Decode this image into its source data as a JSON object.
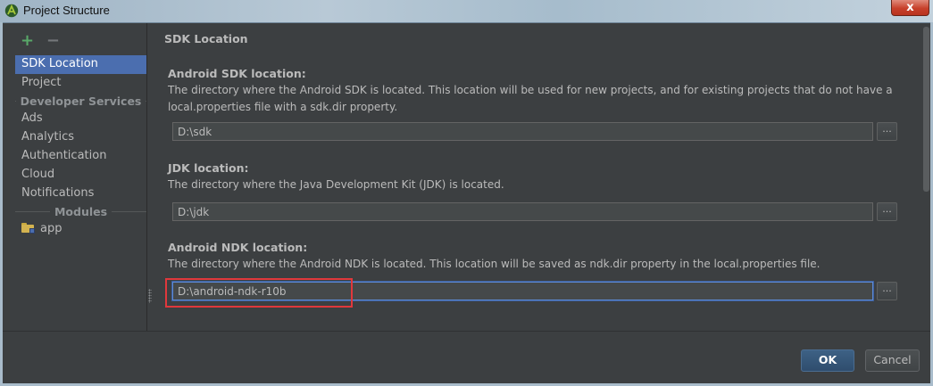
{
  "window": {
    "title": "Project Structure",
    "close_label": "x",
    "app_icon": "android-studio-icon"
  },
  "sidebar": {
    "add_label": "+",
    "remove_label": "−",
    "items": [
      {
        "label": "SDK Location",
        "selected": true
      },
      {
        "label": "Project"
      }
    ],
    "section_developer_services": "Developer Services",
    "services": [
      "Ads",
      "Analytics",
      "Authentication",
      "Cloud",
      "Notifications"
    ],
    "section_modules": "Modules",
    "modules": [
      {
        "label": "app",
        "icon": "module-folder-icon"
      }
    ]
  },
  "main": {
    "title": "SDK Location",
    "sdk": {
      "label": "Android SDK location:",
      "description": "The directory where the Android SDK is located. This location will be used for new projects, and for existing projects that do not have a local.properties file with a sdk.dir property.",
      "value": "D:\\sdk",
      "browse_label": "..."
    },
    "jdk": {
      "label": "JDK location:",
      "description": "The directory where the Java Development Kit (JDK) is located.",
      "value": "D:\\jdk",
      "browse_label": "..."
    },
    "ndk": {
      "label": "Android NDK location:",
      "description": "The directory where the Android NDK is located. This location will be saved as ndk.dir property in the local.properties file.",
      "value": "D:\\android-ndk-r10b",
      "browse_label": "...",
      "highlighted": true
    }
  },
  "buttons": {
    "ok": "OK",
    "cancel": "Cancel"
  },
  "colors": {
    "background": "#3c3f41",
    "selection": "#4b6eaf",
    "highlight_box": "#e0383c",
    "add_icon": "#59a869"
  }
}
